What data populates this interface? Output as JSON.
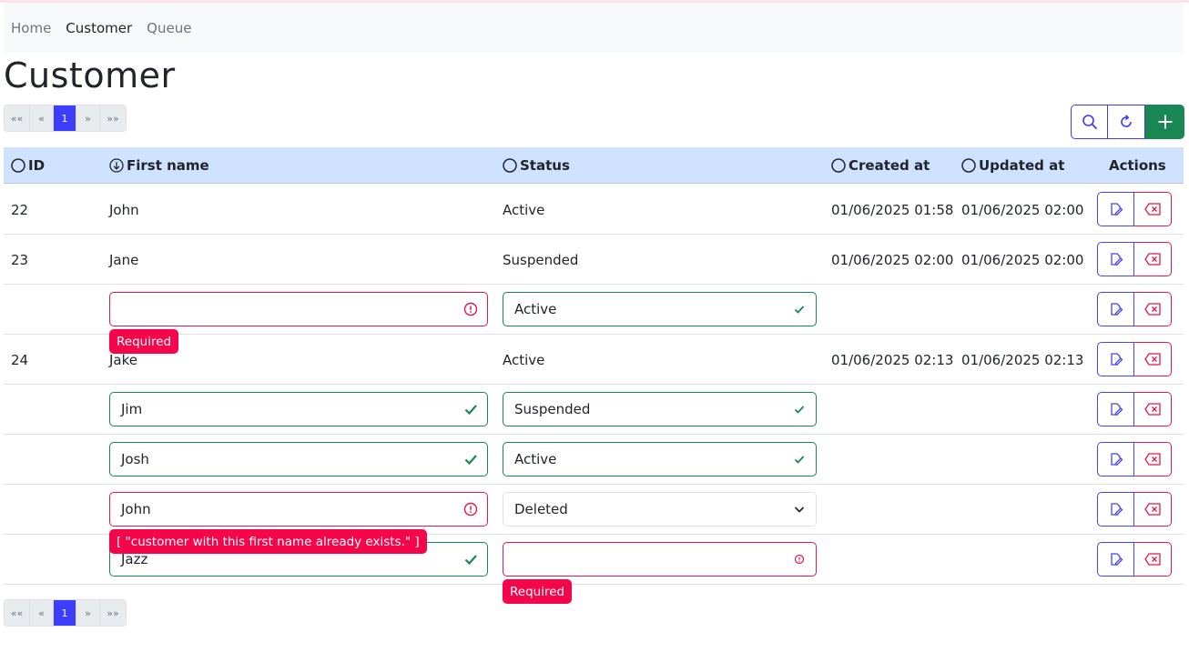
{
  "nav": {
    "items": [
      "Home",
      "Customer",
      "Queue"
    ],
    "active": "Customer"
  },
  "page": {
    "title": "Customer"
  },
  "pager": {
    "first": "««",
    "prev": "«",
    "current": "1",
    "next": "»",
    "last": "»»"
  },
  "toolbar": {
    "search_icon": "search-icon",
    "refresh_icon": "refresh-icon",
    "add_icon": "plus-icon"
  },
  "table": {
    "headers": {
      "id": "ID",
      "first_name": "First name",
      "status": "Status",
      "created_at": "Created at",
      "updated_at": "Updated at",
      "actions": "Actions"
    },
    "rows": [
      {
        "id": "22",
        "first_name": "John",
        "status": "Active",
        "created_at": "01/06/2025 01:58",
        "updated_at": "01/06/2025 02:00"
      },
      {
        "id": "23",
        "first_name": "Jane",
        "status": "Suspended",
        "created_at": "01/06/2025 02:00",
        "updated_at": "01/06/2025 02:00"
      },
      {
        "id": "",
        "first_name": "",
        "status": "Active",
        "created_at": "",
        "updated_at": ""
      },
      {
        "id": "24",
        "first_name": "Jake",
        "status": "Active",
        "created_at": "01/06/2025 02:13",
        "updated_at": "01/06/2025 02:13"
      },
      {
        "id": "",
        "first_name": "Jim",
        "status": "Suspended",
        "created_at": "",
        "updated_at": ""
      },
      {
        "id": "",
        "first_name": "Josh",
        "status": "Active",
        "created_at": "",
        "updated_at": ""
      },
      {
        "id": "",
        "first_name": "John",
        "status": "Deleted",
        "created_at": "",
        "updated_at": ""
      },
      {
        "id": "",
        "first_name": "Jazz",
        "status": "",
        "created_at": "",
        "updated_at": ""
      }
    ]
  },
  "errors": {
    "required": "Required",
    "duplicate": "[ \"customer with this first name already exists.\" ]",
    "required_status": "Required"
  },
  "colors": {
    "primary": "#3d3dff",
    "success": "#198754",
    "danger": "#f5064b",
    "header_bg": "#cfe2ff"
  }
}
